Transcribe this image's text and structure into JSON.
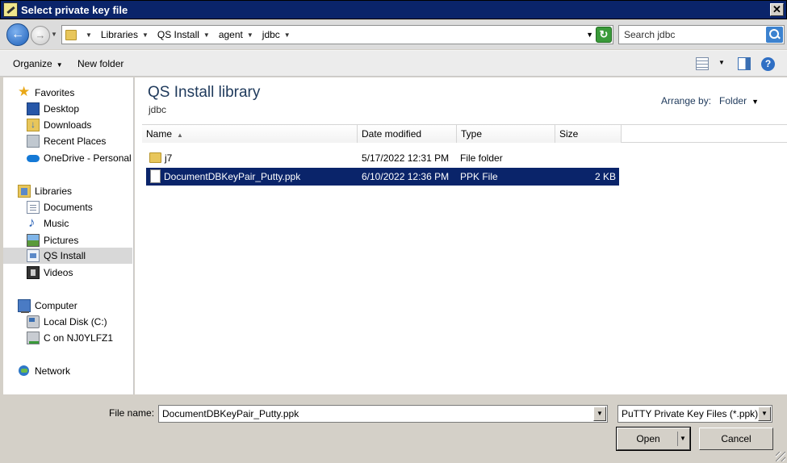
{
  "window": {
    "title": "Select private key file",
    "close_glyph": "✕"
  },
  "address": {
    "crumbs": [
      "Libraries",
      "QS Install",
      "agent",
      "jdbc"
    ],
    "search_placeholder": "Search jdbc"
  },
  "toolbar": {
    "organize_label": "Organize",
    "new_folder_label": "New folder",
    "help_glyph": "?"
  },
  "sidebar": {
    "favorites": {
      "label": "Favorites",
      "items": [
        {
          "label": "Desktop",
          "icon": "desktop-icon"
        },
        {
          "label": "Downloads",
          "icon": "downloads-icon"
        },
        {
          "label": "Recent Places",
          "icon": "recent-places-icon"
        },
        {
          "label": "OneDrive - Personal",
          "icon": "onedrive-icon"
        }
      ]
    },
    "libraries": {
      "label": "Libraries",
      "items": [
        {
          "label": "Documents",
          "icon": "documents-icon"
        },
        {
          "label": "Music",
          "icon": "music-icon"
        },
        {
          "label": "Pictures",
          "icon": "pictures-icon"
        },
        {
          "label": "QS Install",
          "icon": "library-icon",
          "selected": true
        },
        {
          "label": "Videos",
          "icon": "videos-icon"
        }
      ]
    },
    "computer": {
      "label": "Computer",
      "items": [
        {
          "label": "Local Disk (C:)",
          "icon": "disk-icon"
        },
        {
          "label": "C on NJ0YLFZ1",
          "icon": "network-drive-icon"
        }
      ]
    },
    "network": {
      "label": "Network"
    }
  },
  "content": {
    "library_title": "QS Install library",
    "library_subtitle": "jdbc",
    "arrange_label": "Arrange by:",
    "arrange_value": "Folder",
    "columns": [
      "Name",
      "Date modified",
      "Type",
      "Size"
    ],
    "files": [
      {
        "name": "j7",
        "date": "5/17/2022 12:31 PM",
        "type": "File folder",
        "size": "",
        "icon": "folder-icon"
      },
      {
        "name": "DocumentDBKeyPair_Putty.ppk",
        "date": "6/10/2022 12:36 PM",
        "type": "PPK File",
        "size": "2 KB",
        "icon": "file-icon",
        "selected": true
      }
    ]
  },
  "footer": {
    "filename_label": "File name:",
    "filename_value": "DocumentDBKeyPair_Putty.ppk",
    "filetype_value": "PuTTY Private Key Files (*.ppk)",
    "open_label": "Open",
    "cancel_label": "Cancel"
  },
  "colors": {
    "selection": "#0a246a",
    "titlebar": "#0a246a",
    "library_title": "#1e395b"
  }
}
